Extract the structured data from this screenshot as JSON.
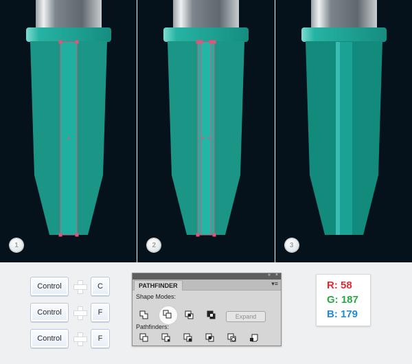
{
  "steps": [
    {
      "number": "1"
    },
    {
      "number": "2"
    },
    {
      "number": "3"
    }
  ],
  "colors": {
    "background": "#05121b",
    "body": "#1a9586",
    "body_final": "#128a7c",
    "ring": "#1fb0a0",
    "stripe": "#3abbb3",
    "selection": "#e0557a"
  },
  "shortcuts": [
    {
      "modifier": "Control",
      "key": "C"
    },
    {
      "modifier": "Control",
      "key": "F"
    },
    {
      "modifier": "Control",
      "key": "F"
    }
  ],
  "pathfinder": {
    "tab_title": "PATHFINDER",
    "collapse_icon": "«",
    "close_icon": "×",
    "menu_icon": "▾≡",
    "shape_modes_label": "Shape Modes:",
    "pathfinders_label": "Pathfinders:",
    "expand_label": "Expand",
    "shape_mode_icons": [
      "unite-icon",
      "minus-front-icon",
      "intersect-icon",
      "exclude-icon"
    ],
    "pathfinder_icons": [
      "divide-icon",
      "trim-icon",
      "merge-icon",
      "crop-icon",
      "outline-icon",
      "minus-back-icon"
    ]
  },
  "rgb": {
    "r_label": "R: 58",
    "g_label": "G: 187",
    "b_label": "B: 179",
    "r_color": "#e8262f",
    "g_color": "#27a844",
    "b_color": "#1e8ad6"
  }
}
